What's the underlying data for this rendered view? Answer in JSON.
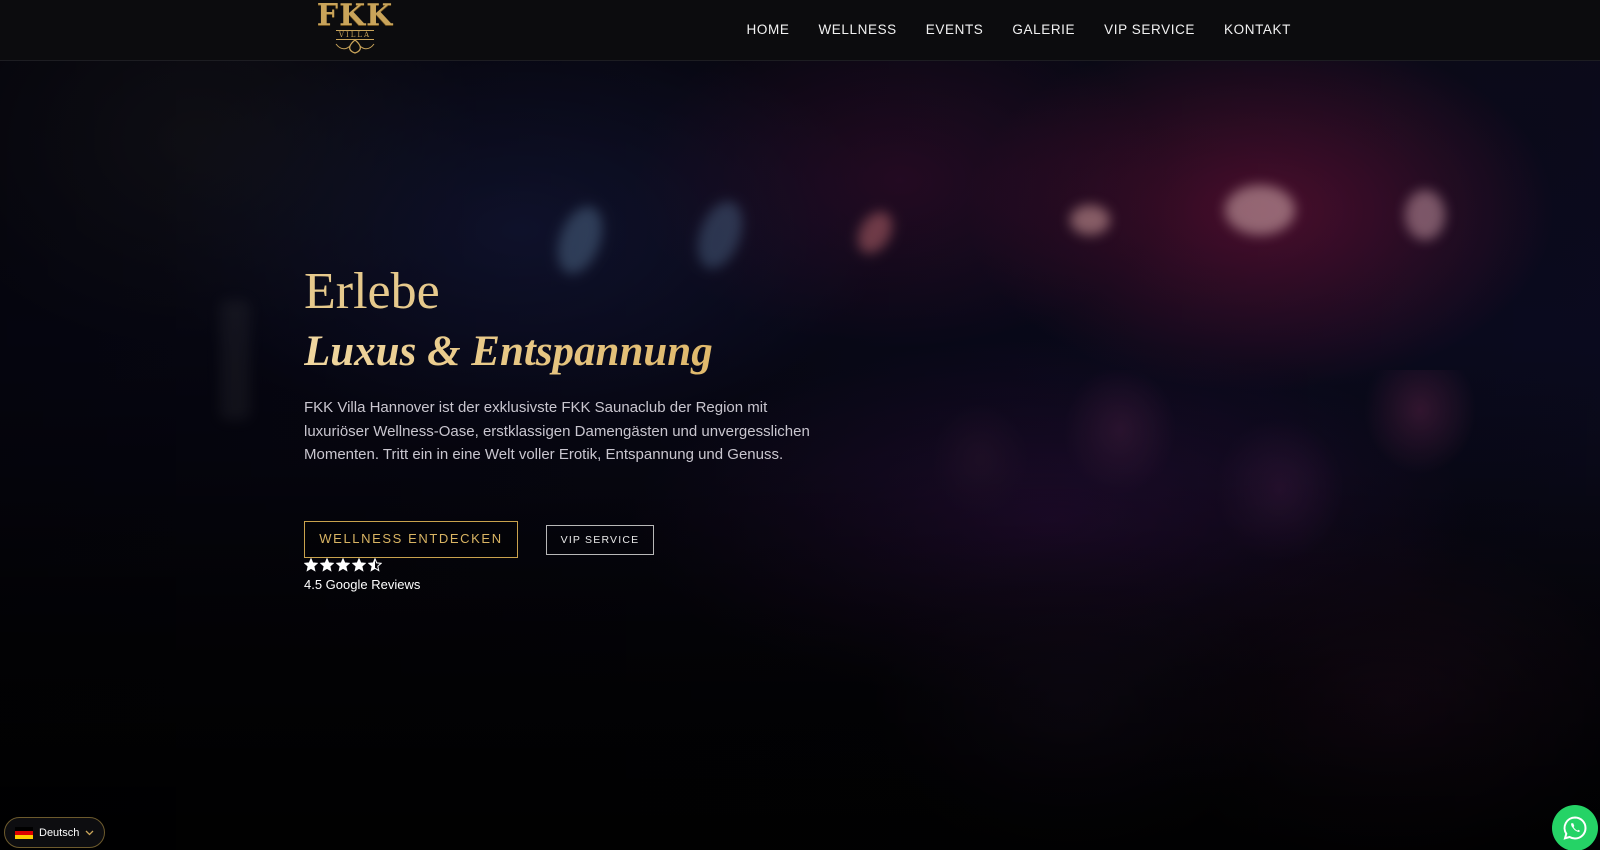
{
  "header": {
    "logo": {
      "title": "FKK",
      "subtitle": "VILLA"
    },
    "nav": [
      {
        "label": "HOME"
      },
      {
        "label": "WELLNESS"
      },
      {
        "label": "EVENTS"
      },
      {
        "label": "GALERIE"
      },
      {
        "label": "VIP SERVICE"
      },
      {
        "label": "KONTAKT"
      }
    ]
  },
  "hero": {
    "headline": "Erlebe",
    "subheadline": "Luxus & Entspannung",
    "description": "FKK Villa Hannover ist der exklusivste FKK Saunaclub der Region mit luxuriöser Wellness-Oase, erstklassigen Damengästen und unvergesslichen Momenten. Tritt ein in eine Welt voller Erotik, Entspannung und Genuss.",
    "primary_button": "WELLNESS ENTDECKEN",
    "secondary_button": "VIP SERVICE",
    "rating": {
      "stars": 4.5,
      "max": 5,
      "label": "4.5 Google Reviews"
    }
  },
  "language_selector": {
    "label": "Deutsch",
    "flag_icon": "germany-flag-icon"
  },
  "whatsapp": {
    "icon": "whatsapp-icon"
  },
  "colors": {
    "gold": "#d9b463",
    "background": "#0c0c0e",
    "whatsapp": "#25d366"
  }
}
